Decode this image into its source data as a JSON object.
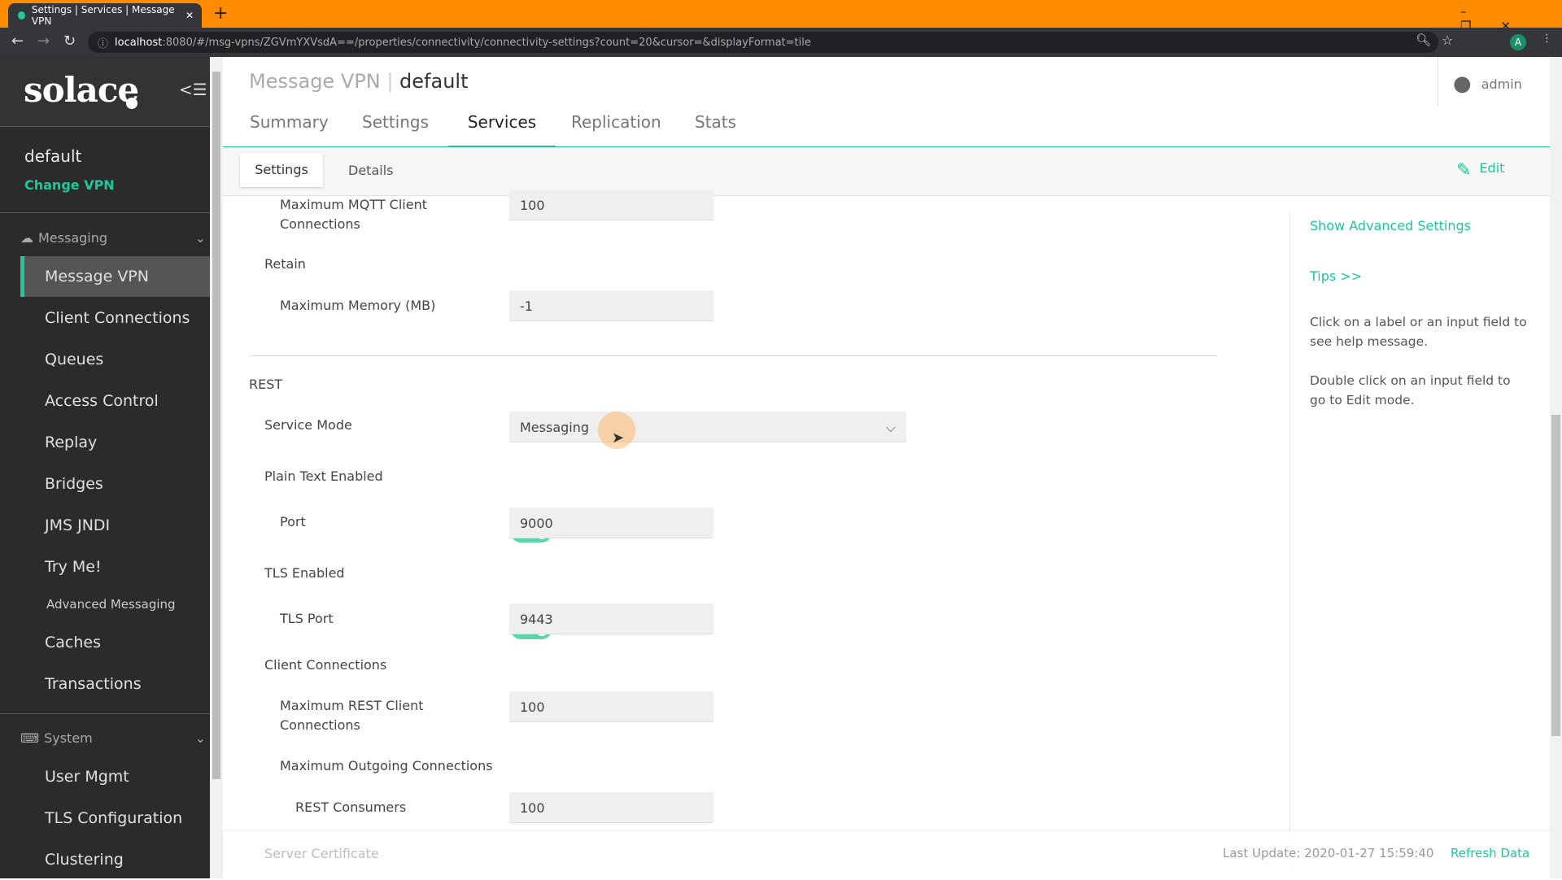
{
  "browser": {
    "tab_title": "Settings | Services | Message VPN",
    "url_host": "localhost",
    "url_rest": ":8080/#/msg-vpns/ZGVmYXVsdA==/properties/connectivity/connectivity-settings?count=20&cursor=&displayFormat=tile",
    "profile": "A"
  },
  "sidebar": {
    "logo": "solace",
    "vpn_name": "default",
    "change_vpn": "Change VPN",
    "group_messaging": "Messaging",
    "items": [
      "Message VPN",
      "Client Connections",
      "Queues",
      "Access Control",
      "Replay",
      "Bridges",
      "JMS JNDI",
      "Try Me!",
      "Advanced Messaging",
      "Caches",
      "Transactions"
    ],
    "group_system": "System",
    "system_items": [
      "User Mgmt",
      "TLS Configuration",
      "Clustering"
    ]
  },
  "header": {
    "title_prefix": "Message VPN",
    "title_sep": "|",
    "title_name": "default",
    "user": "admin"
  },
  "tabs": [
    "Summary",
    "Settings",
    "Services",
    "Replication",
    "Stats"
  ],
  "active_tab": "Services",
  "subtabs": [
    "Settings",
    "Details"
  ],
  "edit": "Edit",
  "form": {
    "max_mqtt_label": "Maximum MQTT Client Connections",
    "max_mqtt": "100",
    "retain": "Retain",
    "max_memory_label": "Maximum Memory (MB)",
    "max_memory": "-1",
    "rest": "REST",
    "service_mode_label": "Service Mode",
    "service_mode": "Messaging",
    "plain_text_label": "Plain Text Enabled",
    "plain_text_enabled": true,
    "port_label": "Port",
    "port": "9000",
    "tls_label": "TLS Enabled",
    "tls_enabled": true,
    "tls_port_label": "TLS Port",
    "tls_port": "9443",
    "client_conn": "Client Connections",
    "max_rest_label": "Maximum REST Client Connections",
    "max_rest": "100",
    "max_outgoing": "Maximum Outgoing Connections",
    "rest_consumers_label": "REST Consumers",
    "rest_consumers": "100",
    "server_cert": "Server Certificate"
  },
  "right": {
    "show_advanced": "Show Advanced Settings",
    "tips": "Tips >>",
    "help1": "Click on a label or an input field to see help message.",
    "help2": "Double click on an input field to go to Edit mode."
  },
  "footer": {
    "last_update": "Last Update: 2020-01-27 15:59:40",
    "refresh": "Refresh Data"
  },
  "colors": {
    "accent": "#1fc79a",
    "browser_frame": "#ff8c00"
  }
}
